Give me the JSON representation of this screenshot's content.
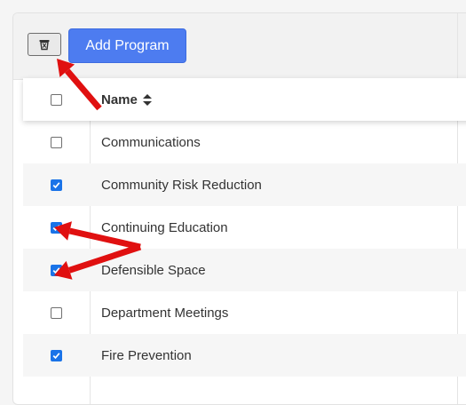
{
  "toolbar": {
    "delete_icon": "trash-icon",
    "add_label": "Add Program"
  },
  "table": {
    "header": {
      "name_label": "Name",
      "sort_icon": "sort-icon"
    },
    "rows": [
      {
        "name": "Communications",
        "checked": false
      },
      {
        "name": "Community Risk Reduction",
        "checked": true
      },
      {
        "name": "Continuing Education",
        "checked": true
      },
      {
        "name": "Defensible Space",
        "checked": true
      },
      {
        "name": "Department Meetings",
        "checked": false
      },
      {
        "name": "Fire Prevention",
        "checked": true
      }
    ]
  },
  "annotations": {
    "arrow_color": "#e01010"
  },
  "colors": {
    "primary": "#4d7cf0",
    "checkbox_checked": "#1a73e8"
  }
}
